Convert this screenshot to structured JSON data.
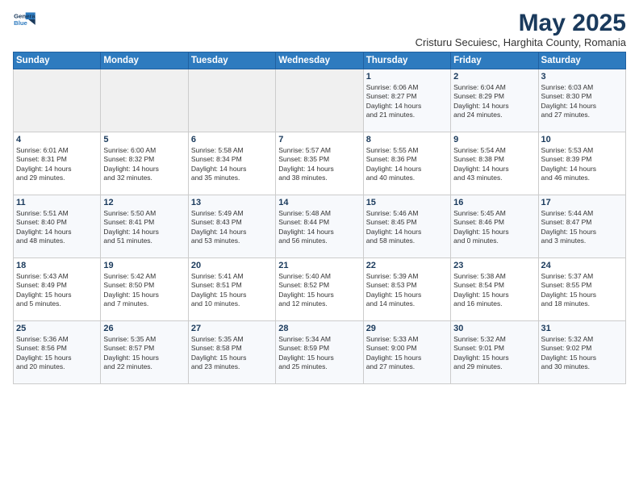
{
  "header": {
    "logo_line1": "General",
    "logo_line2": "Blue",
    "month": "May 2025",
    "location": "Cristuru Secuiesc, Harghita County, Romania"
  },
  "weekdays": [
    "Sunday",
    "Monday",
    "Tuesday",
    "Wednesday",
    "Thursday",
    "Friday",
    "Saturday"
  ],
  "weeks": [
    [
      {
        "day": "",
        "info": ""
      },
      {
        "day": "",
        "info": ""
      },
      {
        "day": "",
        "info": ""
      },
      {
        "day": "",
        "info": ""
      },
      {
        "day": "1",
        "info": "Sunrise: 6:06 AM\nSunset: 8:27 PM\nDaylight: 14 hours\nand 21 minutes."
      },
      {
        "day": "2",
        "info": "Sunrise: 6:04 AM\nSunset: 8:29 PM\nDaylight: 14 hours\nand 24 minutes."
      },
      {
        "day": "3",
        "info": "Sunrise: 6:03 AM\nSunset: 8:30 PM\nDaylight: 14 hours\nand 27 minutes."
      }
    ],
    [
      {
        "day": "4",
        "info": "Sunrise: 6:01 AM\nSunset: 8:31 PM\nDaylight: 14 hours\nand 29 minutes."
      },
      {
        "day": "5",
        "info": "Sunrise: 6:00 AM\nSunset: 8:32 PM\nDaylight: 14 hours\nand 32 minutes."
      },
      {
        "day": "6",
        "info": "Sunrise: 5:58 AM\nSunset: 8:34 PM\nDaylight: 14 hours\nand 35 minutes."
      },
      {
        "day": "7",
        "info": "Sunrise: 5:57 AM\nSunset: 8:35 PM\nDaylight: 14 hours\nand 38 minutes."
      },
      {
        "day": "8",
        "info": "Sunrise: 5:55 AM\nSunset: 8:36 PM\nDaylight: 14 hours\nand 40 minutes."
      },
      {
        "day": "9",
        "info": "Sunrise: 5:54 AM\nSunset: 8:38 PM\nDaylight: 14 hours\nand 43 minutes."
      },
      {
        "day": "10",
        "info": "Sunrise: 5:53 AM\nSunset: 8:39 PM\nDaylight: 14 hours\nand 46 minutes."
      }
    ],
    [
      {
        "day": "11",
        "info": "Sunrise: 5:51 AM\nSunset: 8:40 PM\nDaylight: 14 hours\nand 48 minutes."
      },
      {
        "day": "12",
        "info": "Sunrise: 5:50 AM\nSunset: 8:41 PM\nDaylight: 14 hours\nand 51 minutes."
      },
      {
        "day": "13",
        "info": "Sunrise: 5:49 AM\nSunset: 8:43 PM\nDaylight: 14 hours\nand 53 minutes."
      },
      {
        "day": "14",
        "info": "Sunrise: 5:48 AM\nSunset: 8:44 PM\nDaylight: 14 hours\nand 56 minutes."
      },
      {
        "day": "15",
        "info": "Sunrise: 5:46 AM\nSunset: 8:45 PM\nDaylight: 14 hours\nand 58 minutes."
      },
      {
        "day": "16",
        "info": "Sunrise: 5:45 AM\nSunset: 8:46 PM\nDaylight: 15 hours\nand 0 minutes."
      },
      {
        "day": "17",
        "info": "Sunrise: 5:44 AM\nSunset: 8:47 PM\nDaylight: 15 hours\nand 3 minutes."
      }
    ],
    [
      {
        "day": "18",
        "info": "Sunrise: 5:43 AM\nSunset: 8:49 PM\nDaylight: 15 hours\nand 5 minutes."
      },
      {
        "day": "19",
        "info": "Sunrise: 5:42 AM\nSunset: 8:50 PM\nDaylight: 15 hours\nand 7 minutes."
      },
      {
        "day": "20",
        "info": "Sunrise: 5:41 AM\nSunset: 8:51 PM\nDaylight: 15 hours\nand 10 minutes."
      },
      {
        "day": "21",
        "info": "Sunrise: 5:40 AM\nSunset: 8:52 PM\nDaylight: 15 hours\nand 12 minutes."
      },
      {
        "day": "22",
        "info": "Sunrise: 5:39 AM\nSunset: 8:53 PM\nDaylight: 15 hours\nand 14 minutes."
      },
      {
        "day": "23",
        "info": "Sunrise: 5:38 AM\nSunset: 8:54 PM\nDaylight: 15 hours\nand 16 minutes."
      },
      {
        "day": "24",
        "info": "Sunrise: 5:37 AM\nSunset: 8:55 PM\nDaylight: 15 hours\nand 18 minutes."
      }
    ],
    [
      {
        "day": "25",
        "info": "Sunrise: 5:36 AM\nSunset: 8:56 PM\nDaylight: 15 hours\nand 20 minutes."
      },
      {
        "day": "26",
        "info": "Sunrise: 5:35 AM\nSunset: 8:57 PM\nDaylight: 15 hours\nand 22 minutes."
      },
      {
        "day": "27",
        "info": "Sunrise: 5:35 AM\nSunset: 8:58 PM\nDaylight: 15 hours\nand 23 minutes."
      },
      {
        "day": "28",
        "info": "Sunrise: 5:34 AM\nSunset: 8:59 PM\nDaylight: 15 hours\nand 25 minutes."
      },
      {
        "day": "29",
        "info": "Sunrise: 5:33 AM\nSunset: 9:00 PM\nDaylight: 15 hours\nand 27 minutes."
      },
      {
        "day": "30",
        "info": "Sunrise: 5:32 AM\nSunset: 9:01 PM\nDaylight: 15 hours\nand 29 minutes."
      },
      {
        "day": "31",
        "info": "Sunrise: 5:32 AM\nSunset: 9:02 PM\nDaylight: 15 hours\nand 30 minutes."
      }
    ]
  ]
}
